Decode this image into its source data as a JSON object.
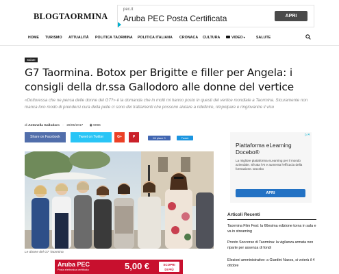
{
  "header": {
    "logo": "BLOGTAORMINA",
    "ad": {
      "url": "pec.it",
      "title": "Aruba PEC Posta Certificata",
      "button": "APRI"
    }
  },
  "nav": {
    "items": [
      "HOME",
      "TURISMO",
      "ATTUALITÀ",
      "POLITICA TAORMINA",
      "POLITICA ITALIANA",
      "CRONACA",
      "CULTURA",
      "VIDEO",
      "SALUTE"
    ]
  },
  "article": {
    "category": "Salute",
    "title": "G7 Taormina. Botox per Brigitte e filler per Angela: i consigli della dr.ssa Gallodoro alle donne del vertice",
    "subtitle": "«Dottoressa che ne pensa delle donne del G7?» è la domanda che in molti mi hanno posto in questi del vertice mondiale a Taormina. Sicuramente non manca loro modo di prendersi cura della pelle ci sono dei trattamenti che possono aiutare a ridefinire, rimpolpare e ringiovanire il viso",
    "meta": {
      "by": "di",
      "author": "Antonella Gallodoro",
      "date": "28/05/2017",
      "views": "9096"
    },
    "share": {
      "facebook": "Share on Facebook",
      "twitter": "Tweet on Twitter",
      "gplus": "G+",
      "pinterest": "P",
      "like": "Mi piace 0",
      "tweet": "Tweet"
    },
    "caption": "Le donne del G7 Taormina"
  },
  "ad_bottom": {
    "title": "Aruba PEC",
    "subtitle": "Posta elettronica certificata",
    "price": "5,00 €",
    "badge_line1": "SCOPRI",
    "badge_line2": "DI PIÙ"
  },
  "ad_right": {
    "title": "Piattaforma eLearning Docebo®",
    "description": "La migliore piattaforma eLearning per il mondo aziendale. Sfrutta l'AI e aumenta l'efficacia della formazione. Docebo",
    "button": "APRI"
  },
  "sidebar": {
    "recent_title": "Articoli Recenti",
    "items": [
      "Taormina Film Fest: la 66esima edizione torna in sala e va in streaming",
      "Pronto Soccorso di Taormina: la vigilanza armata non riparte per assenza di fondi",
      "Elezioni amministrative: a Giardini Naxos, si voterà il 4 ottobre"
    ]
  },
  "colors": {
    "facebook": "#516eab",
    "twitter": "#29c5f6",
    "gplus": "#eb4026",
    "pinterest": "#ca212a",
    "ad_button": "#2372c4",
    "aruba_red": "#c8102e"
  }
}
